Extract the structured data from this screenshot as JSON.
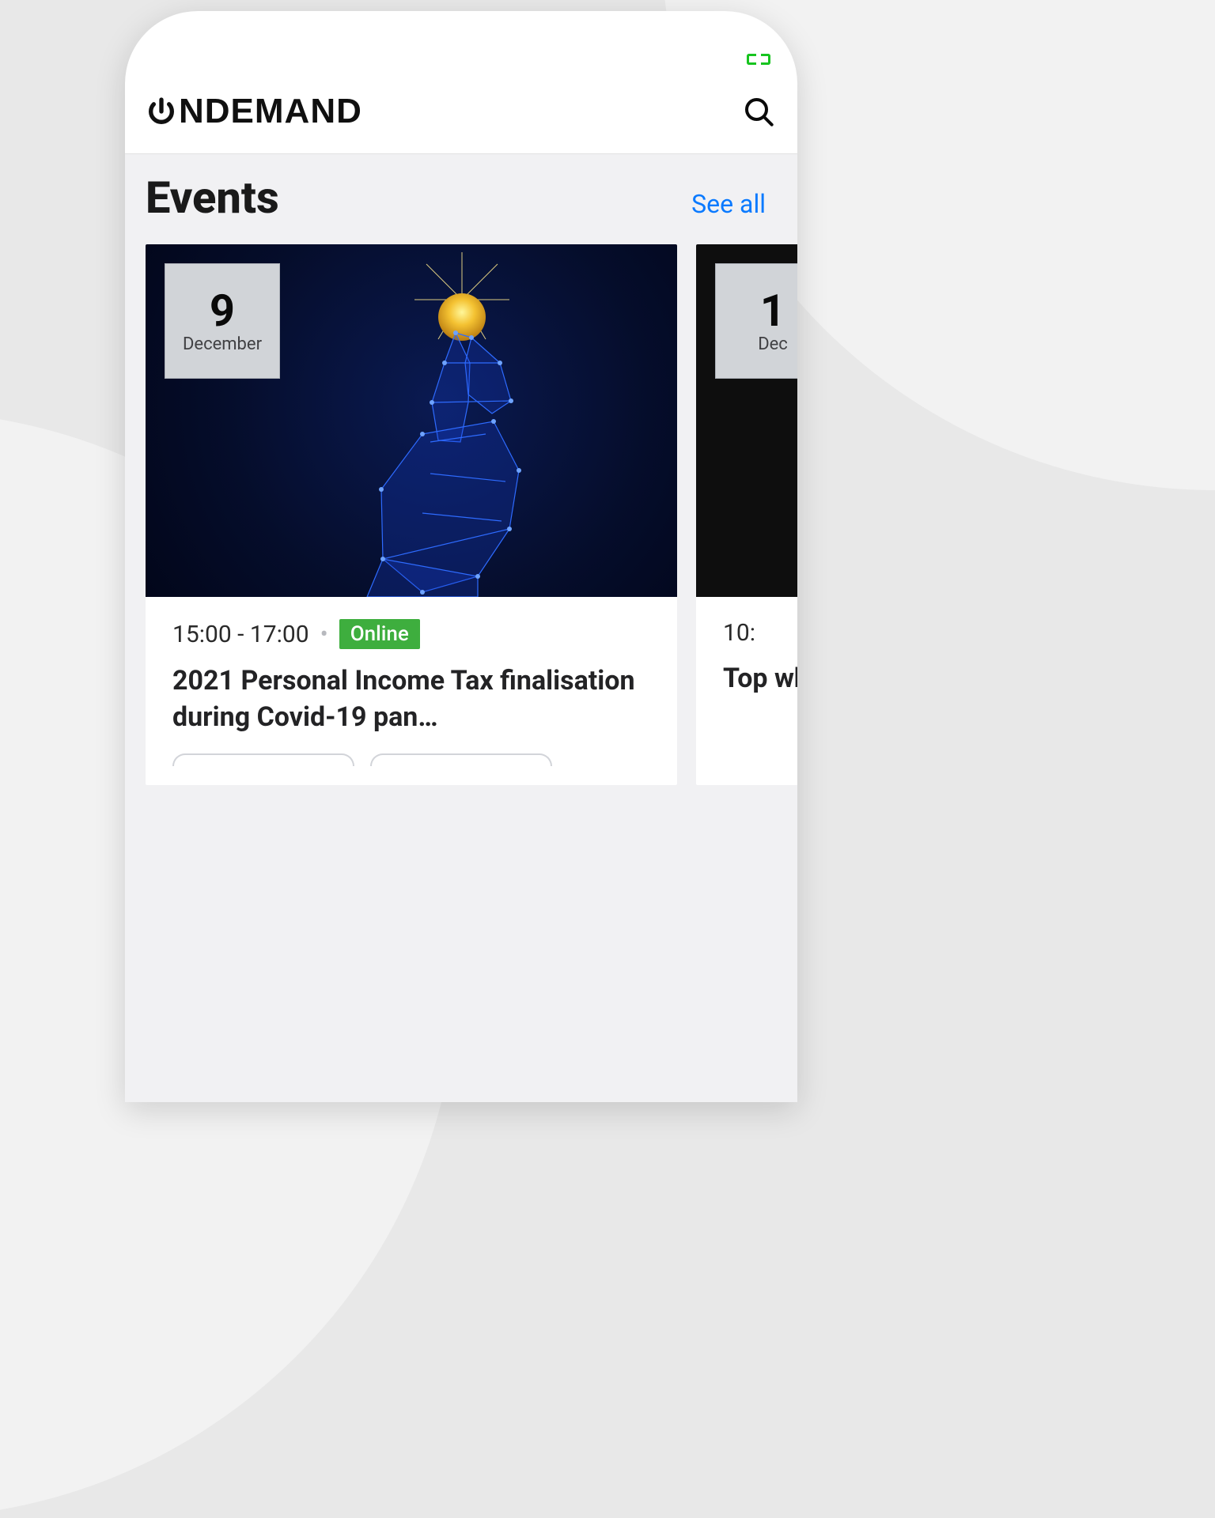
{
  "brand": {
    "name": "NDEMAND"
  },
  "section": {
    "title": "Events",
    "see_all_label": "See all"
  },
  "events": [
    {
      "date_day": "9",
      "date_month": "December",
      "time_range": "15:00 - 17:00",
      "mode_label": "Online",
      "title": "2021 Personal Income Tax finalisation during Covid-19 pan…"
    },
    {
      "date_day": "1",
      "date_month": "Dec",
      "time_range": "10:",
      "mode_label": "",
      "title": "Top wh"
    }
  ]
}
